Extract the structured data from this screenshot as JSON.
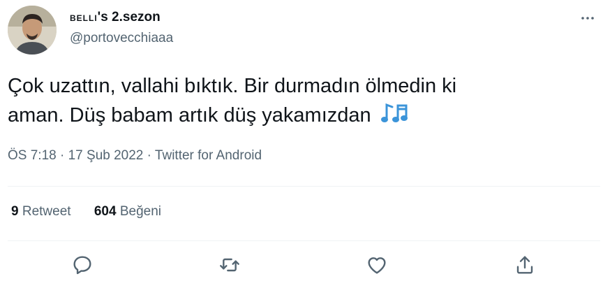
{
  "author": {
    "display_name_prefix": "belli",
    "display_name_suffix": "'s 2.sezon",
    "handle": "@portovecchiaaa"
  },
  "tweet": {
    "line1": "Çok uzattın, vallahi bıktık. Bir durmadın ölmedin ki",
    "line2": "aman. Düş babam artık düş yakamızdan",
    "emoji_icon": "musical-notes-icon",
    "time": "ÖS 7:18",
    "sep1": " · ",
    "date": "17 Şub 2022",
    "sep2": " · ",
    "source": "Twitter for Android"
  },
  "stats": {
    "retweet_count": "9",
    "retweet_label": "Retweet",
    "like_count": "604",
    "like_label": "Beğeni"
  },
  "actions": [
    "reply-icon",
    "retweet-icon",
    "like-icon",
    "share-icon"
  ],
  "colors": {
    "text": "#0f1419",
    "secondary": "#536471",
    "divider": "#eff3f4",
    "emoji": "#3b94d9"
  }
}
